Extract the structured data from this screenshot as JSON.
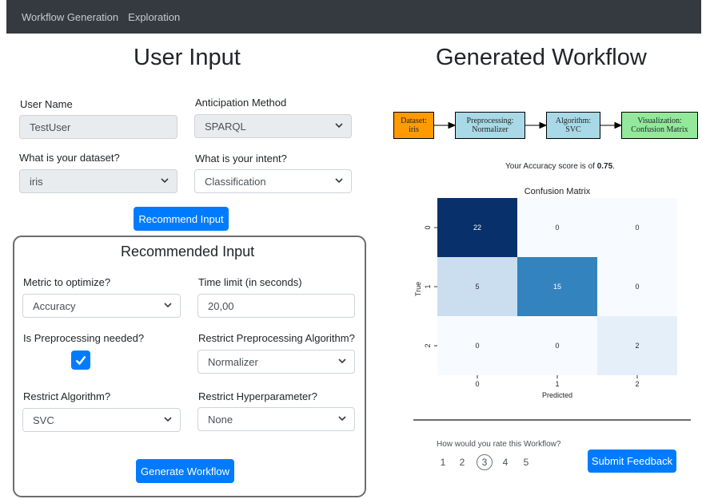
{
  "nav": {
    "items": [
      "Workflow Generation",
      "Exploration"
    ]
  },
  "user_input": {
    "title": "User Input",
    "user_name": {
      "label": "User Name",
      "value": "TestUser"
    },
    "anticipation_method": {
      "label": "Anticipation Method",
      "value": "SPARQL"
    },
    "dataset": {
      "label": "What is your dataset?",
      "value": "iris"
    },
    "intent": {
      "label": "What is your intent?",
      "value": "Classification"
    },
    "recommend_button": "Recommend Input"
  },
  "recommended_input": {
    "title": "Recommended Input",
    "metric": {
      "label": "Metric to optimize?",
      "value": "Accuracy"
    },
    "time_limit": {
      "label": "Time limit (in seconds)",
      "value": "20,00"
    },
    "preprocessing_needed": {
      "label": "Is Preprocessing needed?",
      "checked": true
    },
    "restrict_preprocessing": {
      "label": "Restrict Preprocessing Algorithm?",
      "value": "Normalizer"
    },
    "restrict_algorithm": {
      "label": "Restrict Algorithm?",
      "value": "SVC"
    },
    "restrict_hyperparameter": {
      "label": "Restrict Hyperparameter?",
      "value": "None"
    },
    "generate_button": "Generate Workflow"
  },
  "generated_workflow": {
    "title": "Generated Workflow",
    "nodes": [
      {
        "line1": "Dataset:",
        "line2": "iris",
        "color": "#ff9b00"
      },
      {
        "line1": "Preprocessing:",
        "line2": "Normalizer",
        "color": "#a9d9e6"
      },
      {
        "line1": "Algorithm:",
        "line2": "SVC",
        "color": "#a9d9e6"
      },
      {
        "line1": "Visualization:",
        "line2": "Confusion Matrix",
        "color": "#93e89b"
      }
    ],
    "accuracy_prefix": "Your Accuracy score is of ",
    "accuracy_value": "0.75",
    "accuracy_suffix": "."
  },
  "chart_data": {
    "type": "heatmap",
    "title": "Confusion Matrix",
    "xlabel": "Predicted",
    "ylabel": "True",
    "x_categories": [
      "0",
      "1",
      "2"
    ],
    "y_categories": [
      "0",
      "1",
      "2"
    ],
    "values": [
      [
        22,
        0,
        0
      ],
      [
        5,
        15,
        0
      ],
      [
        0,
        0,
        2
      ]
    ],
    "colormap": "Blues"
  },
  "feedback": {
    "question": "How would you rate this Workflow?",
    "options": [
      "1",
      "2",
      "3",
      "4",
      "5"
    ],
    "selected": "3",
    "submit_button": "Submit Feedback"
  }
}
